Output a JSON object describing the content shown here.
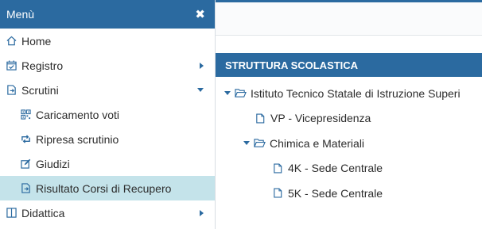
{
  "sidebar": {
    "title": "Menù",
    "close_icon": "close-icon",
    "items": [
      {
        "label": "Home",
        "icon": "home-icon"
      },
      {
        "label": "Registro",
        "icon": "calendar-check-icon",
        "caret": "right"
      },
      {
        "label": "Scrutini",
        "icon": "document-export-icon",
        "caret": "down"
      },
      {
        "label": "Caricamento voti",
        "icon": "qrcode-icon"
      },
      {
        "label": "Ripresa scrutinio",
        "icon": "retweet-icon"
      },
      {
        "label": "Giudizi",
        "icon": "edit-icon"
      },
      {
        "label": "Risultato Corsi di Recupero",
        "icon": "document-export-icon",
        "active": true
      },
      {
        "label": "Didattica",
        "icon": "columns-icon",
        "caret": "right"
      }
    ]
  },
  "main": {
    "section_title": "STRUTTURA SCOLASTICA",
    "tree": [
      {
        "label": "Istituto Tecnico Statale di Istruzione Superi",
        "type": "folder"
      },
      {
        "label": "VP - Vicepresidenza",
        "type": "file"
      },
      {
        "label": "Chimica e Materiali",
        "type": "folder"
      },
      {
        "label": "4K - Sede Centrale",
        "type": "file"
      },
      {
        "label": "5K - Sede Centrale",
        "type": "file"
      }
    ]
  },
  "colors": {
    "primary": "#2b6aa0",
    "active_bg": "#c4e3ea"
  }
}
